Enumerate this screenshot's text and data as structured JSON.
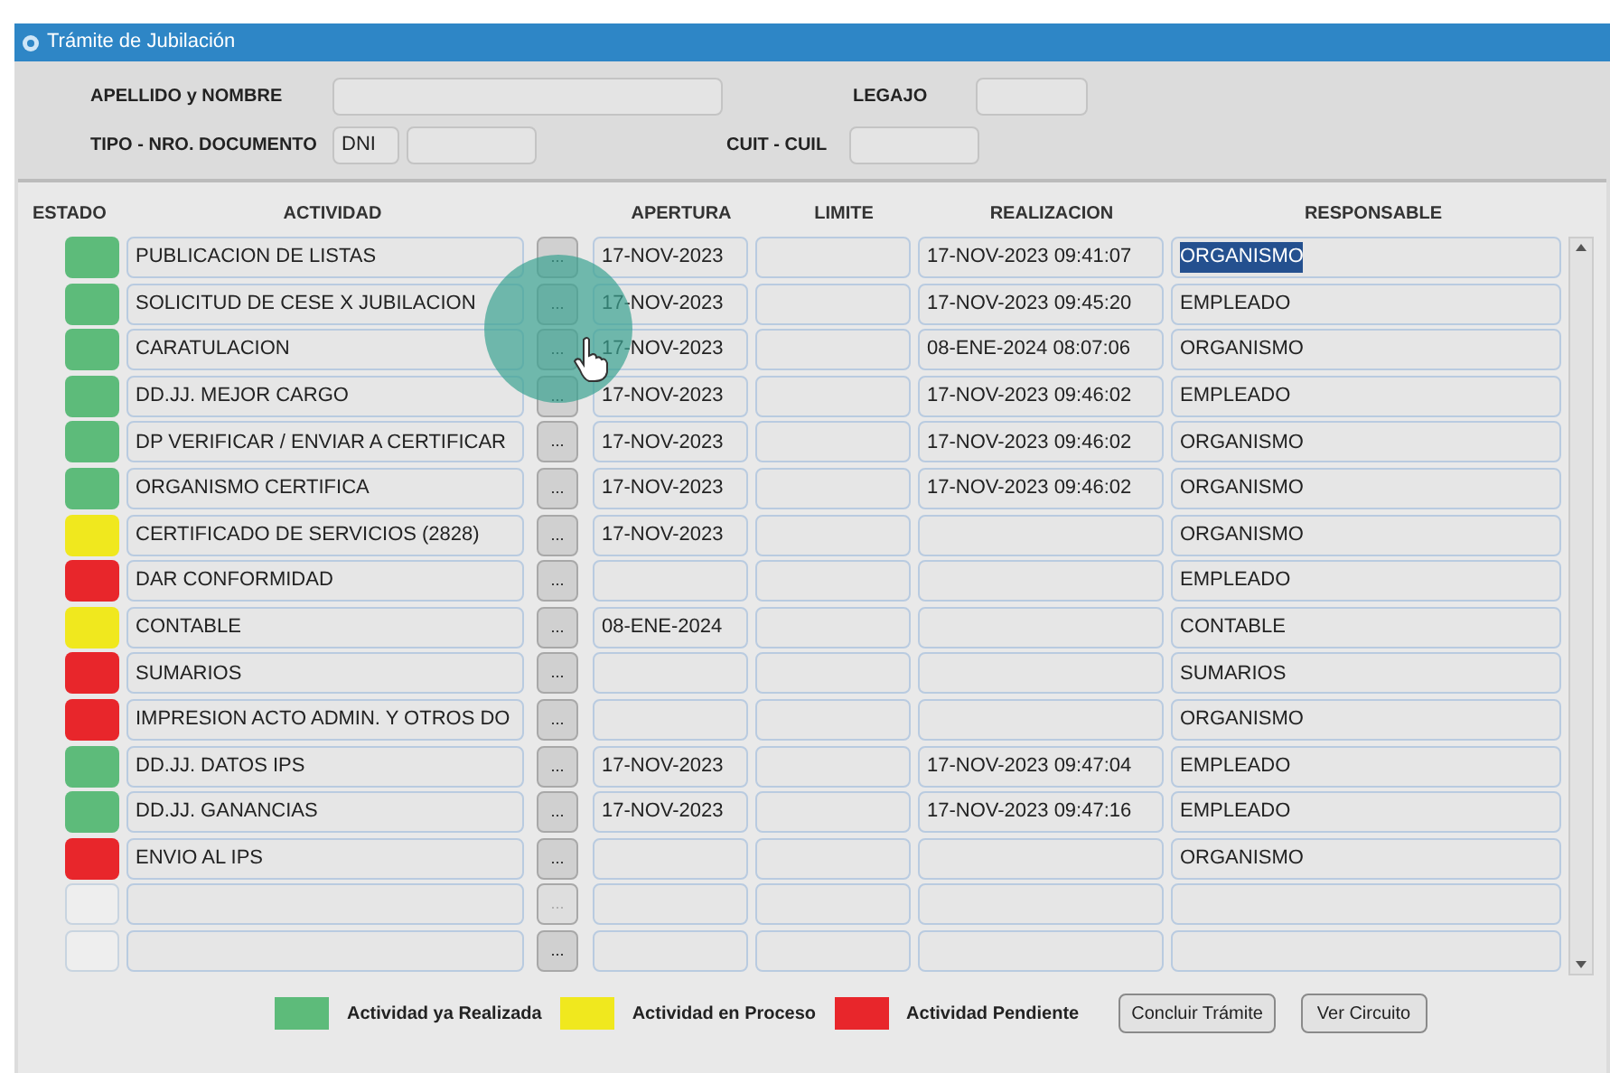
{
  "window": {
    "title": "Trámite de Jubilación"
  },
  "form": {
    "fields": [
      {
        "label": "APELLIDO y NOMBRE"
      },
      {
        "label": "LEGAJO"
      },
      {
        "label": "TIPO - NRO. DOCUMENTO",
        "type": "DNI"
      },
      {
        "label": "CUIT - CUIL"
      }
    ]
  },
  "table": {
    "columns": [
      "ESTADO",
      "ACTIVIDAD",
      "APERTURA",
      "LIMITE",
      "REALIZACION",
      "RESPONSABLE"
    ],
    "rows": [
      {
        "kind": "activity",
        "color": "#5dbb7a",
        "actividad": "PUBLICACION DE LISTAS",
        "button": "...",
        "button_disabled": false,
        "apertura": "17-NOV-2023",
        "realizacion": "17-NOV-2023 09:41:07",
        "responsable": "ORGANISMO",
        "selected": true
      },
      {
        "kind": "activity",
        "color": "#5dbb7a",
        "actividad": "SOLICITUD DE CESE X JUBILACION",
        "button": "...",
        "button_disabled": false,
        "apertura": "17-NOV-2023",
        "realizacion": "17-NOV-2023 09:45:20",
        "responsable": "EMPLEADO",
        "selected": false
      },
      {
        "kind": "activity",
        "color": "#5dbb7a",
        "actividad": "CARATULACION",
        "button": "...",
        "button_disabled": false,
        "apertura": "17-NOV-2023",
        "realizacion": "08-ENE-2024 08:07:06",
        "responsable": "ORGANISMO",
        "selected": false
      },
      {
        "kind": "activity",
        "color": "#5dbb7a",
        "actividad": "DD.JJ. MEJOR CARGO",
        "button": "...",
        "button_disabled": false,
        "apertura": "17-NOV-2023",
        "realizacion": "17-NOV-2023 09:46:02",
        "responsable": "EMPLEADO",
        "selected": false
      },
      {
        "kind": "activity",
        "color": "#5dbb7a",
        "actividad": "DP VERIFICAR / ENVIAR A CERTIFICAR",
        "button": "...",
        "button_disabled": false,
        "apertura": "17-NOV-2023",
        "realizacion": "17-NOV-2023 09:46:02",
        "responsable": "ORGANISMO",
        "selected": false
      },
      {
        "kind": "activity",
        "color": "#5dbb7a",
        "actividad": "ORGANISMO CERTIFICA",
        "button": "...",
        "button_disabled": false,
        "apertura": "17-NOV-2023",
        "realizacion": "17-NOV-2023 09:46:02",
        "responsable": "ORGANISMO",
        "selected": false
      },
      {
        "kind": "activity",
        "color": "#f0e81e",
        "actividad": "CERTIFICADO DE SERVICIOS (2828)",
        "button": "...",
        "button_disabled": false,
        "apertura": "17-NOV-2023",
        "responsable": "ORGANISMO",
        "selected": false
      },
      {
        "kind": "activity",
        "color": "#e8262b",
        "actividad": "DAR CONFORMIDAD",
        "button": "...",
        "button_disabled": false,
        "responsable": "EMPLEADO",
        "selected": false
      },
      {
        "kind": "activity",
        "color": "#f0e81e",
        "actividad": "CONTABLE",
        "button": "...",
        "button_disabled": false,
        "apertura": "08-ENE-2024",
        "responsable": "CONTABLE",
        "selected": false
      },
      {
        "kind": "activity",
        "color": "#e8262b",
        "actividad": "SUMARIOS",
        "button": "...",
        "button_disabled": false,
        "responsable": "SUMARIOS",
        "selected": false
      },
      {
        "kind": "activity",
        "color": "#e8262b",
        "actividad": "IMPRESION ACTO ADMIN. Y OTROS DO",
        "button": "...",
        "button_disabled": false,
        "responsable": "ORGANISMO",
        "selected": false
      },
      {
        "kind": "activity",
        "color": "#5dbb7a",
        "actividad": "DD.JJ. DATOS IPS",
        "button": "...",
        "button_disabled": false,
        "apertura": "17-NOV-2023",
        "realizacion": "17-NOV-2023 09:47:04",
        "responsable": "EMPLEADO",
        "selected": false
      },
      {
        "kind": "activity",
        "color": "#5dbb7a",
        "actividad": "DD.JJ. GANANCIAS",
        "button": "...",
        "button_disabled": false,
        "apertura": "17-NOV-2023",
        "realizacion": "17-NOV-2023 09:47:16",
        "responsable": "EMPLEADO",
        "selected": false
      },
      {
        "kind": "activity",
        "color": "#e8262b",
        "actividad": "ENVIO AL IPS",
        "button": "...",
        "button_disabled": false,
        "responsable": "ORGANISMO",
        "selected": false
      },
      {
        "kind": "empty",
        "button": "...",
        "button_disabled": true
      },
      {
        "kind": "empty",
        "button": "...",
        "button_disabled": false
      }
    ]
  },
  "cursor": {
    "highlight": true
  },
  "legend": [
    {
      "label": "Actividad ya Realizada",
      "color": "#5dbb7a"
    },
    {
      "label": "Actividad en Proceso",
      "color": "#f0e81e"
    },
    {
      "label": "Actividad Pendiente",
      "color": "#e8262b"
    }
  ],
  "buttons": [
    "Concluir Trámite",
    "Ver Circuito"
  ]
}
